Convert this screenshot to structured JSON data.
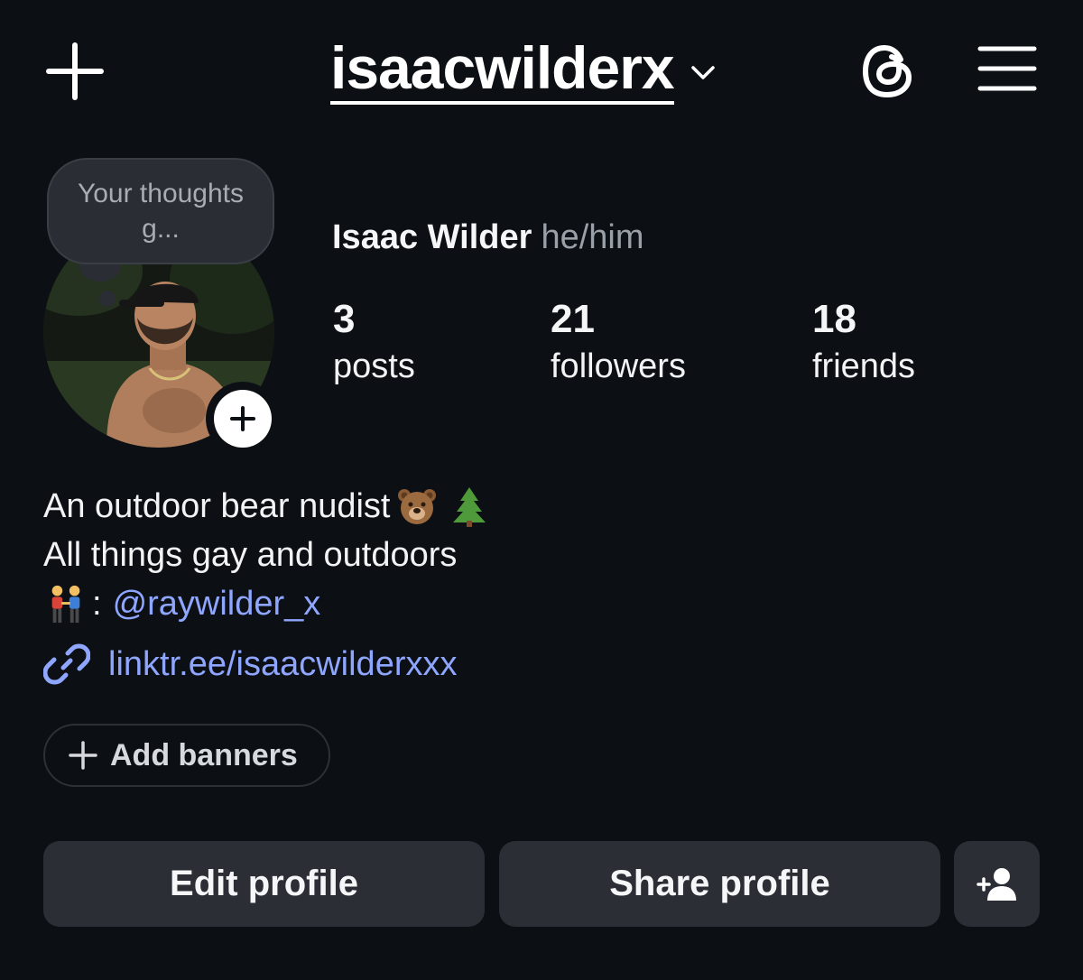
{
  "header": {
    "username": "isaacwilderx",
    "icons": {
      "new_post": "plus-icon",
      "username_dropdown": "chevron-down-icon",
      "threads": "threads-icon",
      "menu": "hamburger-menu-icon"
    }
  },
  "profile": {
    "thought_bubble": "Your thoughts g...",
    "display_name": "Isaac Wilder",
    "pronouns": "he/him",
    "avatar_icon": "avatar-photo",
    "add_story_icon": "plus-icon"
  },
  "stats": [
    {
      "value": "3",
      "label": "posts"
    },
    {
      "value": "21",
      "label": "followers"
    },
    {
      "value": "18",
      "label": "friends"
    }
  ],
  "bio": {
    "line1": "An outdoor bear nudist",
    "line1_emojis": [
      "bear-face-emoji",
      "evergreen-tree-emoji"
    ],
    "line2": "All things gay and outdoors",
    "line3_prefix_emoji": "two-men-holding-hands-emoji",
    "line3_separator": ":",
    "line3_mention": "@raywilder_x",
    "link": "linktr.ee/isaacwilderxxx",
    "link_icon": "link-icon"
  },
  "actions": {
    "add_banners": "Add banners",
    "edit_profile": "Edit profile",
    "share_profile": "Share profile",
    "add_friend_icon": "add-person-icon"
  },
  "colors": {
    "background": "#0c0f14",
    "button": "#2b2e34",
    "link": "#8fa6ff",
    "muted_text": "#9aa0a8"
  }
}
